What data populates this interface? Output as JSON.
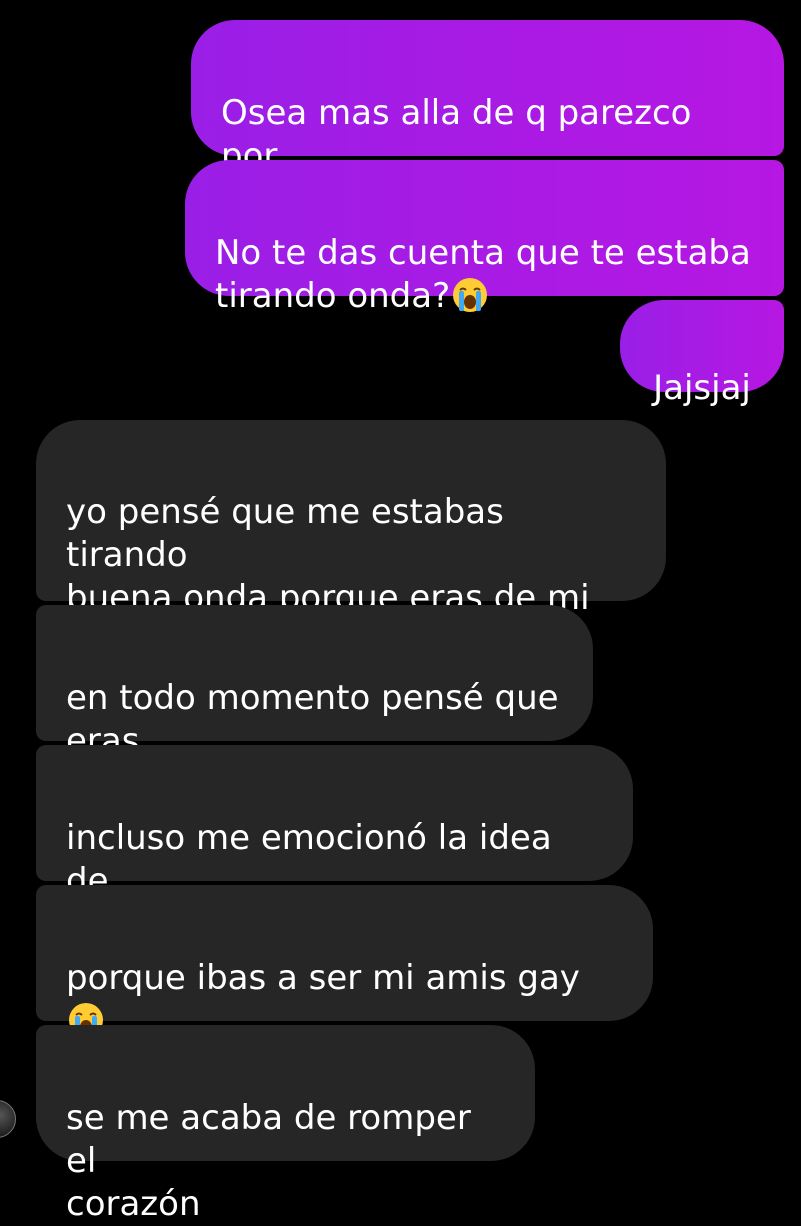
{
  "sent_messages": [
    {
      "text": "Osea mas alla de q parezco por\nmis gustos"
    },
    {
      "text": "No te das cuenta que te estaba\ntirando onda?"
    },
    {
      "text": "Jajsjaj"
    }
  ],
  "received_messages": [
    {
      "text": "yo pensé que me estabas tirando\nbuena onda porque eras de mi\nbando "
    },
    {
      "text": "en todo momento pensé que\neras"
    },
    {
      "text": "incluso me emocionó la idea de\nque lo fueras"
    },
    {
      "text": "porque ibas a ser mi amis gay "
    },
    {
      "text": "se me acaba de romper el\ncorazón"
    }
  ],
  "emoji_name": "loudly-crying-face-emoji",
  "colors": {
    "background": "#000000",
    "sent_bubble_start": "#9a1fe6",
    "sent_bubble_end": "#b617e2",
    "received_bubble": "#262626",
    "text": "#ffffff"
  }
}
